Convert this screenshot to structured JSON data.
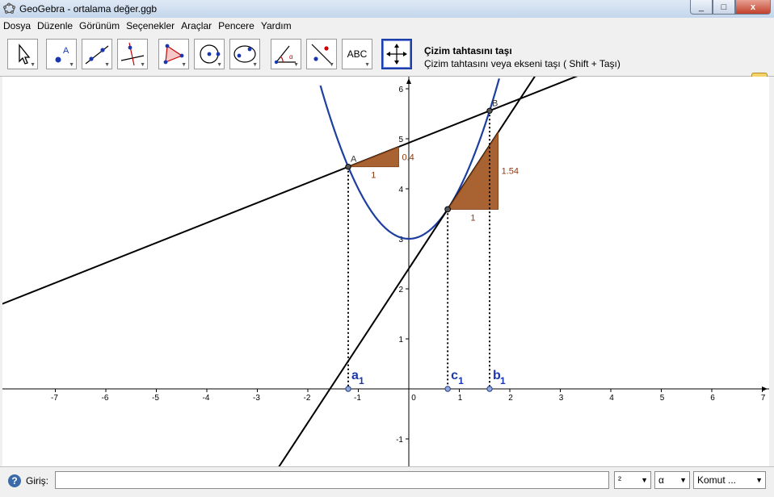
{
  "window": {
    "title": "GeoGebra - ortalama değer.ggb",
    "controls": [
      "_",
      "□",
      "x"
    ]
  },
  "menu": [
    "Dosya",
    "Düzenle",
    "Görünüm",
    "Seçenekler",
    "Araçlar",
    "Pencere",
    "Yardım"
  ],
  "toolbar": {
    "tools": [
      {
        "name": "move-tool",
        "icon": "pointer-arrow-icon"
      },
      {
        "name": "point-tool",
        "icon": "point-icon"
      },
      {
        "name": "line-tool",
        "icon": "line-through-points-icon"
      },
      {
        "name": "perpendicular-tool",
        "icon": "perpendicular-line-icon"
      },
      {
        "name": "polygon-tool",
        "icon": "polygon-icon"
      },
      {
        "name": "circle-tool",
        "icon": "circle-center-icon"
      },
      {
        "name": "conic-tool",
        "icon": "ellipse-icon"
      },
      {
        "name": "angle-tool",
        "icon": "angle-icon"
      },
      {
        "name": "reflect-tool",
        "icon": "reflect-line-icon"
      },
      {
        "name": "text-tool",
        "icon": "text-icon",
        "label": "ABC"
      },
      {
        "name": "move-graphics-tool",
        "icon": "move-view-icon",
        "selected": true
      }
    ],
    "active_tool_name": "Çizim tahtasını taşı",
    "active_tool_desc": "Çizim tahtasını veya ekseni taşı ( Shift + Taşı)"
  },
  "graphics": {
    "x_ticks": [
      "-7",
      "-6",
      "-5",
      "-4",
      "-3",
      "-2",
      "-1",
      "0",
      "1",
      "2",
      "3",
      "4",
      "5",
      "6",
      "7"
    ],
    "y_ticks": [
      "-1",
      "1",
      "2",
      "3",
      "4",
      "5",
      "6"
    ],
    "points": [
      {
        "label": "A",
        "x": -1.2,
        "y": 4.44
      },
      {
        "label": "B",
        "x": 1.6,
        "y": 5.56
      }
    ],
    "tangent_point": {
      "x": 0.77,
      "y": 3.59
    },
    "foot_labels": [
      {
        "main": "a",
        "sub": "1",
        "x": -1.2
      },
      {
        "main": "c",
        "sub": "1",
        "x": 0.77
      },
      {
        "main": "b",
        "sub": "1",
        "x": 1.6
      }
    ],
    "slope_triangles": [
      {
        "run_label": "1",
        "rise_label": "0.4",
        "x": -1.2,
        "y": 4.44,
        "slope": 0.4
      },
      {
        "run_label": "1",
        "rise_label": "1.54",
        "x": 0.77,
        "y": 3.59,
        "slope": 1.54
      }
    ],
    "colors": {
      "curve": "#1c3fa0",
      "line": "#000000",
      "triangle": "#a0521c",
      "labels": "#1a37b0"
    }
  },
  "inputbar": {
    "label": "Giriş:",
    "value": "",
    "combo1": "²",
    "combo2": "α",
    "combo3": "Komut ..."
  }
}
